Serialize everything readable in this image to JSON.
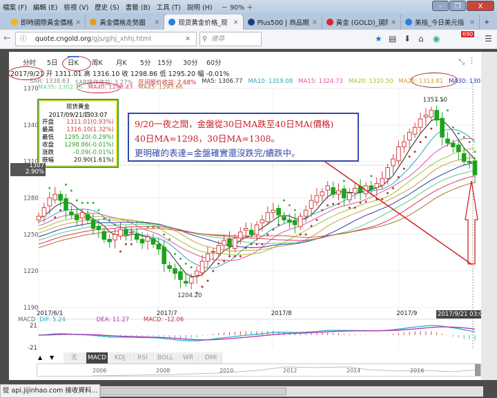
{
  "menu": [
    "檔案 (F)",
    "編輯 (E)",
    "檢視 (V)",
    "歷史 (S)",
    "書籤 (B)",
    "工具 (T)",
    "說明 (H)"
  ],
  "zoom": "90%",
  "tabs": [
    {
      "label": "即時國際黃金價格",
      "color": "#f2b417"
    },
    {
      "label": "黃金價格走勢圖",
      "color": "#e0a020"
    },
    {
      "label": "现货黄金价格_现",
      "color": "#2b7de0"
    },
    {
      "label": "Plus500 | 商品期",
      "color": "#1d3c78"
    },
    {
      "label": "黃金 (GOLD)_國際",
      "color": "#d3282a"
    },
    {
      "label": "美指_今日美元指",
      "color": "#2b7de0"
    }
  ],
  "url_domain": "quote.cngold.org",
  "url_path": "/gjs/gjhj_xhhj.html",
  "search_placeholder": "搜尋",
  "badge": "690",
  "periods": [
    "分时",
    "5日",
    "日K",
    "周K",
    "月K",
    "5分",
    "15分",
    "30分",
    "60分"
  ],
  "info": {
    "date": "2017/9/21",
    "text": "开 1311.01  高 1316.10  收 1298.86  低 1295.20  幅 -0.01%"
  },
  "ma_row1": [
    {
      "t": "SAR: 1338.63",
      "c": "#888"
    },
    {
      "t": "SAR操作收益: 3.27%",
      "c": "#888"
    },
    {
      "t": "区间股价收益: 2.68%",
      "c": "#c03030"
    },
    {
      "t": "MA5: 1306.77",
      "c": "#333"
    },
    {
      "t": "MA10: 1319.08",
      "c": "#2aa6b8"
    },
    {
      "t": "MA15: 1324.73",
      "c": "#e0559a"
    },
    {
      "t": "MA20: 1320.50",
      "c": "#9ec23a"
    },
    {
      "t": "MA25: 1313.81",
      "c": "#c8a040"
    },
    {
      "t": "MA30: 1308.56",
      "c": "#2a3bb0"
    }
  ],
  "ma_row2": [
    {
      "t": "MA35: 1302.76",
      "c": "#55d07a"
    },
    {
      "t": "MA40: 1298.43",
      "c": "#e0306a"
    },
    {
      "t": "MA45: 1293.66",
      "c": "#b07030"
    }
  ],
  "yticks": [
    "1370",
    "1340",
    "1310",
    "1280",
    "1250",
    "1220",
    "1190"
  ],
  "xticks": [
    "2017/6/1",
    "2017/7",
    "2017/8",
    "2017/9"
  ],
  "cursor_date": "2017/9/21 03:07",
  "cursor_price": "1307",
  "cursor_pct": "2.90%",
  "high_label": "1357.50",
  "low_label": "1204.20",
  "tooltip": {
    "title": "现货黄金",
    "date": "2017/09/21/四03:07",
    "rows": [
      {
        "k": "开盘",
        "v": "1311.01(0.93%)",
        "c": "#d04040"
      },
      {
        "k": "最高",
        "v": "1316.10(1.32%)",
        "c": "#d04040"
      },
      {
        "k": "最低",
        "v": "1295.20(-0.29%)",
        "c": "#30a030"
      },
      {
        "k": "收盘",
        "v": "1298.86(-0.01%)",
        "c": "#30a030"
      },
      {
        "k": "涨跌",
        "v": "-0.09(-0.01%)",
        "c": "#30a030"
      },
      {
        "k": "振幅",
        "v": "20.90(1.61%)",
        "c": "#222"
      }
    ]
  },
  "note": {
    "line1": "9/20一夜之間，金盤從30日MA跌至40日MA(價格)",
    "line2": "40日MA=1298，30日MA=1308。",
    "line3": "更明確的表達=金盤確實還沒跌完/續跌中。"
  },
  "macd": {
    "label": "MACD",
    "dif": "DIF: 5.24",
    "dea": "DEA: 11.27",
    "macd": "MACD: -12.06",
    "top": "21",
    "bottom": "-21"
  },
  "ind_tabs": [
    "无",
    "MACD",
    "KDJ",
    "RSI",
    "BOLL",
    "WR",
    "DMI"
  ],
  "nav_years": [
    "2006",
    "2008",
    "2010",
    "2012",
    "2014",
    "2016"
  ],
  "status": "從 api.jijinhao.com 接收資料...",
  "chart_data": {
    "type": "candlestick",
    "ylim": [
      1190,
      1370
    ],
    "closes": [
      1265,
      1272,
      1280,
      1283,
      1278,
      1270,
      1266,
      1262,
      1268,
      1262,
      1255,
      1254,
      1246,
      1244,
      1250,
      1254,
      1250,
      1252,
      1246,
      1243,
      1248,
      1242,
      1238,
      1226,
      1222,
      1218,
      1213,
      1210,
      1215,
      1220,
      1228,
      1234,
      1236,
      1241,
      1245,
      1240,
      1247,
      1252,
      1255,
      1250,
      1258,
      1262,
      1268,
      1270,
      1266,
      1262,
      1260,
      1258,
      1265,
      1270,
      1278,
      1282,
      1285,
      1290,
      1283,
      1286,
      1280,
      1284,
      1288,
      1285,
      1290,
      1287,
      1292,
      1296,
      1305,
      1312,
      1322,
      1326,
      1334,
      1338,
      1345,
      1348,
      1352,
      1344,
      1330,
      1325,
      1322,
      1318,
      1310,
      1309,
      1299
    ]
  }
}
